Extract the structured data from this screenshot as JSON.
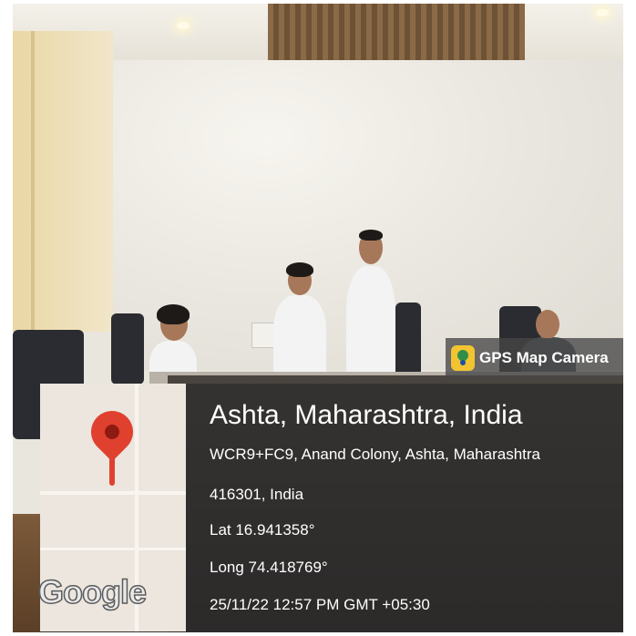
{
  "badge": {
    "app_name": "GPS Map Camera",
    "icon": "gps-map-camera-icon"
  },
  "location": {
    "title": "Ashta, Maharashtra, India",
    "address_line1": "WCR9+FC9, Anand Colony, Ashta, Maharashtra",
    "address_line2": "416301, India",
    "latitude": "Lat 16.941358°",
    "longitude": "Long 74.418769°",
    "timestamp": "25/11/22 12:57 PM GMT +05:30"
  },
  "map": {
    "provider": "Google",
    "pin_icon": "map-pin-icon",
    "pin_color": "#e0412f"
  }
}
